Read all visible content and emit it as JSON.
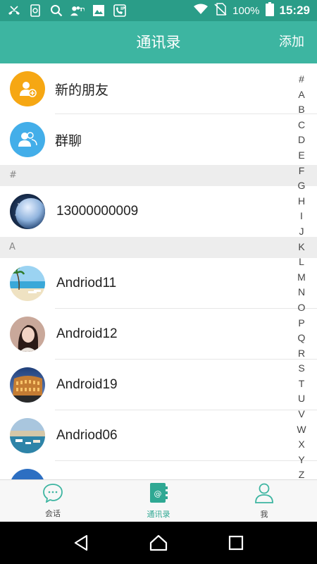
{
  "status_bar": {
    "battery_percent": "100%",
    "time": "15:29",
    "icons": [
      "missed-call-icon",
      "sim-app-icon",
      "search-icon",
      "contacts-notify-icon",
      "gallery-icon",
      "ip-call-icon",
      "wifi-icon",
      "no-sim-icon",
      "battery-icon"
    ]
  },
  "header": {
    "title": "通讯录",
    "add_label": "添加"
  },
  "top_items": [
    {
      "label": "新的朋友",
      "icon": "add-friend-icon",
      "color": "#f6a713"
    },
    {
      "label": "群聊",
      "icon": "group-chat-icon",
      "color": "#43aee9"
    }
  ],
  "sections": [
    {
      "header": "#",
      "contacts": [
        {
          "name": "13000000009",
          "avatar": "planet-avatar"
        }
      ]
    },
    {
      "header": "A",
      "contacts": [
        {
          "name": "Andriod11",
          "avatar": "beach-avatar"
        },
        {
          "name": "Android12",
          "avatar": "woman-avatar"
        },
        {
          "name": "Android19",
          "avatar": "colosseum-avatar"
        },
        {
          "name": "Andriod06",
          "avatar": "harbor-avatar"
        }
      ]
    }
  ],
  "index_letters": [
    "#",
    "A",
    "B",
    "C",
    "D",
    "E",
    "F",
    "G",
    "H",
    "I",
    "J",
    "K",
    "L",
    "M",
    "N",
    "O",
    "P",
    "Q",
    "R",
    "S",
    "T",
    "U",
    "V",
    "W",
    "X",
    "Y",
    "Z"
  ],
  "tabs": [
    {
      "label": "会话",
      "icon": "chat-bubble-icon",
      "active": false
    },
    {
      "label": "通讯录",
      "icon": "contacts-book-icon",
      "active": true
    },
    {
      "label": "我",
      "icon": "person-icon",
      "active": false
    }
  ],
  "colors": {
    "accent": "#3db5a1",
    "status_bar": "#2a9d88",
    "active_tab": "#2fa893"
  }
}
